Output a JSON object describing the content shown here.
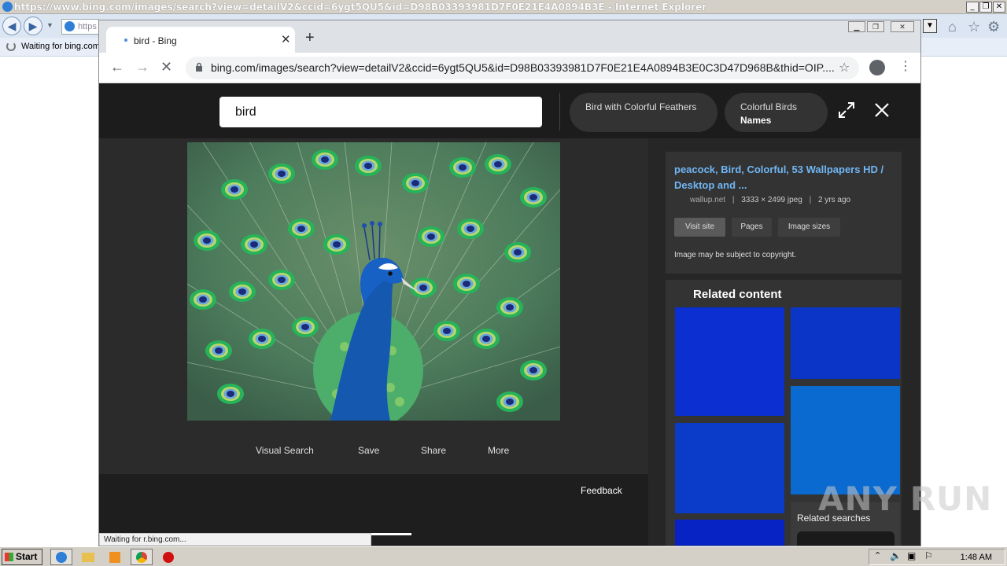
{
  "ie": {
    "title": "https://www.bing.com/images/search?view=detailV2&ccid=6ygt5QU5&id=D98B03393981D7F0E21E4A0894B3E - Internet Explorer",
    "address_fragment": "https",
    "tab_label": "Waiting for bing.com",
    "min_label": "_",
    "restore_label": "❐",
    "close_label": "✕"
  },
  "chrome": {
    "tab_title": "bird - Bing",
    "url": "bing.com/images/search?view=detailV2&ccid=6ygt5QU5&id=D98B03393981D7F0E21E4A0894B3E0C3D47D968B&thid=OIP....",
    "status": "Waiting for r.bing.com..."
  },
  "bing": {
    "search_value": "bird",
    "pills": [
      {
        "line1": "Bird with Colorful Feathers",
        "line2": ""
      },
      {
        "line1": "Colorful Birds",
        "line2": "Names"
      }
    ],
    "actions": [
      "Visual Search",
      "Save",
      "Share",
      "More"
    ],
    "feedback": "Feedback",
    "info": {
      "title": "peacock, Bird, Colorful, 53 Wallpapers HD / Desktop and ...",
      "source": "wallup.net",
      "dimensions": "3333 × 2499 jpeg",
      "age": "2 yrs ago",
      "buttons": [
        "Visit site",
        "Pages",
        "Image sizes"
      ],
      "copyright": "Image may be subject to copyright."
    },
    "related_title": "Related content",
    "related_searches": "Related searches",
    "tile_colors": [
      "#0b2fd1",
      "#0a35c7",
      "#0a3bc9",
      "#0a6ad0",
      "#0723c4"
    ]
  },
  "taskbar": {
    "start": "Start",
    "clock": "1:48 AM"
  },
  "watermark": "ANY RUN"
}
